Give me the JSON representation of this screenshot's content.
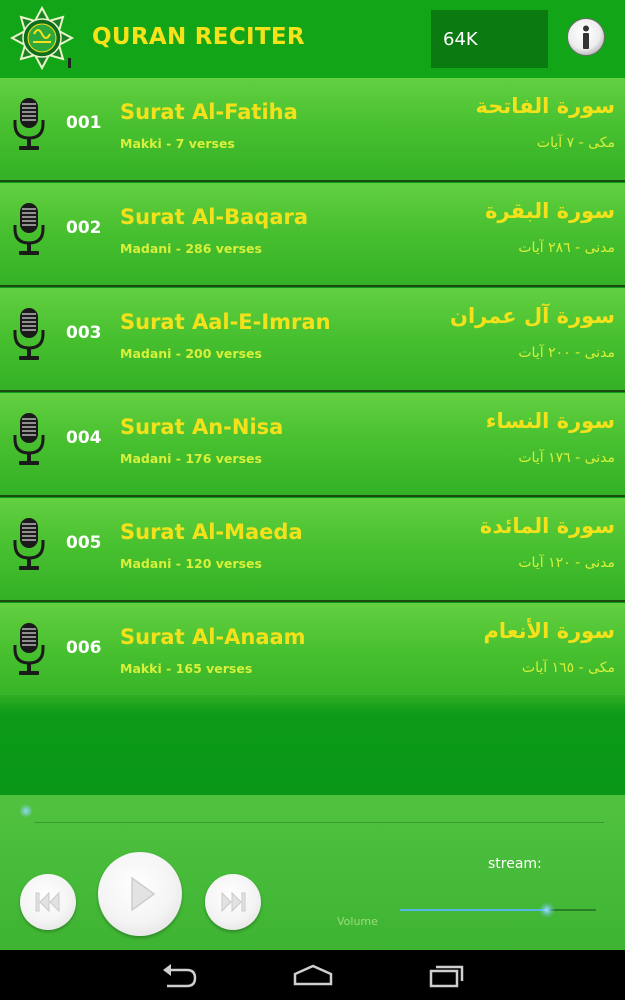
{
  "header": {
    "title": "QURAN RECITER",
    "bitrate": "64K",
    "info_label": "i"
  },
  "surahs": [
    {
      "number": "001",
      "name": "Surat Al-Fatiha",
      "details": "Makki - 7 verses",
      "arabic_name": "سورة الفاتحة",
      "arabic_details": "مكى - ٧ آيات"
    },
    {
      "number": "002",
      "name": "Surat Al-Baqara",
      "details": "Madani - 286 verses",
      "arabic_name": "سورة البقرة",
      "arabic_details": "مدنى - ٢٨٦ آيات"
    },
    {
      "number": "003",
      "name": "Surat Aal-E-Imran",
      "details": "Madani - 200 verses",
      "arabic_name": "سورة آل عمران",
      "arabic_details": "مدنى - ٢٠٠ آيات"
    },
    {
      "number": "004",
      "name": "Surat An-Nisa",
      "details": "Madani - 176 verses",
      "arabic_name": "سورة النساء",
      "arabic_details": "مدنى - ١٧٦ آيات"
    },
    {
      "number": "005",
      "name": "Surat Al-Maeda",
      "details": "Madani - 120 verses",
      "arabic_name": "سورة المائدة",
      "arabic_details": "مدنى - ١٢٠ آيات"
    },
    {
      "number": "006",
      "name": "Surat Al-Anaam",
      "details": "Makki - 165 verses",
      "arabic_name": "سورة الأنعام",
      "arabic_details": "مكى - ١٦٥ آيات"
    }
  ],
  "player": {
    "stream_label": "stream:",
    "volume_label": "Volume",
    "volume_level": 0.75,
    "seek_position": 0
  },
  "icons": {
    "logo": "quran-logo-icon",
    "info": "info-icon",
    "microphone": "microphone-icon",
    "previous": "skip-previous-icon",
    "play": "play-icon",
    "next": "skip-next-icon",
    "back": "back-icon",
    "home": "home-icon",
    "recents": "recents-icon"
  },
  "colors": {
    "header_bg": "#12a517",
    "title_yellow": "#f5e21a",
    "bitrate_bg": "#0b7a10",
    "row_green": "#49c130",
    "subtitle_green": "#d8f03a",
    "volume_blue": "#58b6e6"
  }
}
